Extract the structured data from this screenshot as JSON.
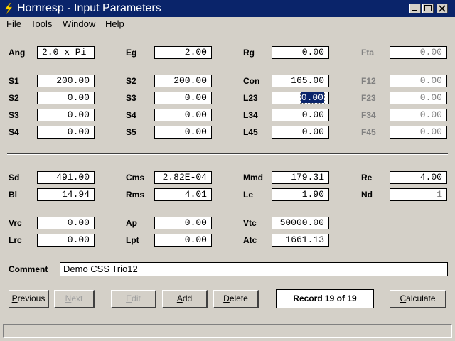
{
  "window": {
    "title": "Hornresp - Input Parameters",
    "controls": [
      "minimize",
      "maximize",
      "close"
    ]
  },
  "menu": [
    "File",
    "Tools",
    "Window",
    "Help"
  ],
  "params_top": [
    {
      "label": "Ang",
      "value": "2.0 x Pi",
      "disabled": false
    },
    {
      "label": "Eg",
      "value": "2.00",
      "disabled": false
    },
    {
      "label": "Rg",
      "value": "0.00",
      "disabled": false
    },
    {
      "label": "Fta",
      "value": "0.00",
      "disabled": true
    },
    {
      "label": "S1",
      "value": "200.00",
      "disabled": false
    },
    {
      "label": "S2",
      "value": "200.00",
      "disabled": false
    },
    {
      "label": "Con",
      "value": "165.00",
      "disabled": false
    },
    {
      "label": "F12",
      "value": "0.00",
      "disabled": true
    },
    {
      "label": "S2",
      "value": "0.00",
      "disabled": false
    },
    {
      "label": "S3",
      "value": "0.00",
      "disabled": false
    },
    {
      "label": "L23",
      "value": "0.00",
      "disabled": false,
      "selected": true
    },
    {
      "label": "F23",
      "value": "0.00",
      "disabled": true
    },
    {
      "label": "S3",
      "value": "0.00",
      "disabled": false
    },
    {
      "label": "S4",
      "value": "0.00",
      "disabled": false
    },
    {
      "label": "L34",
      "value": "0.00",
      "disabled": false
    },
    {
      "label": "F34",
      "value": "0.00",
      "disabled": true
    },
    {
      "label": "S4",
      "value": "0.00",
      "disabled": false
    },
    {
      "label": "S5",
      "value": "0.00",
      "disabled": false
    },
    {
      "label": "L45",
      "value": "0.00",
      "disabled": false
    },
    {
      "label": "F45",
      "value": "0.00",
      "disabled": true
    }
  ],
  "params_driver": [
    {
      "label": "Sd",
      "value": "491.00"
    },
    {
      "label": "Cms",
      "value": "2.82E-04"
    },
    {
      "label": "Mmd",
      "value": "179.31"
    },
    {
      "label": "Re",
      "value": "4.00"
    },
    {
      "label": "Bl",
      "value": "14.94"
    },
    {
      "label": "Rms",
      "value": "4.01"
    },
    {
      "label": "Le",
      "value": "1.90"
    },
    {
      "label": "Nd",
      "value": "1"
    },
    {
      "label": "Vrc",
      "value": "0.00"
    },
    {
      "label": "Ap",
      "value": "0.00"
    },
    {
      "label": "Vtc",
      "value": "50000.00"
    },
    {
      "label": "Lrc",
      "value": "0.00"
    },
    {
      "label": "Lpt",
      "value": "0.00"
    },
    {
      "label": "Atc",
      "value": "1661.13"
    }
  ],
  "comment": {
    "label": "Comment",
    "value": "Demo CSS Trio12"
  },
  "buttons": {
    "previous": "Previous",
    "next": "Next",
    "edit": "Edit",
    "add": "Add",
    "delete": "Delete",
    "calculate": "Calculate"
  },
  "record": "Record 19 of 19",
  "status": ""
}
